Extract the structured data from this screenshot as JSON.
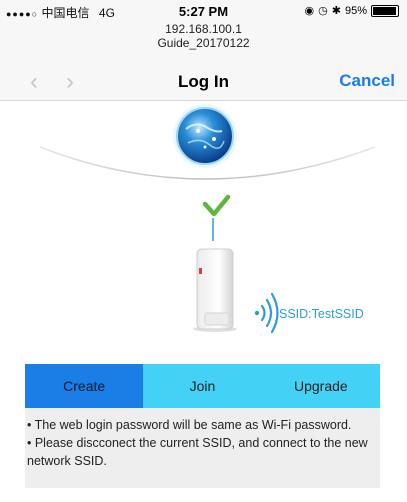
{
  "status": {
    "signal_dots": "●●●●○",
    "carrier": "中国电信",
    "network": "4G",
    "time": "5:27 PM",
    "icons": [
      "lock-rotation-icon",
      "alarm-icon",
      "bluetooth-icon"
    ],
    "battery": "95%",
    "battery_level": 0.95
  },
  "url": {
    "host": "192.168.100.1",
    "page": "Guide_20170122"
  },
  "nav": {
    "back_icon": "‹",
    "forward_icon": "›",
    "title": "Log In",
    "cancel_label": "Cancel"
  },
  "diagram": {
    "ssid_label": "SSID:TestSSID",
    "accent": "#2e9be0",
    "check_color": "#5db83a"
  },
  "tabs": {
    "items": [
      {
        "label": "Create",
        "active": true
      },
      {
        "label": "Join",
        "active": false
      },
      {
        "label": "Upgrade",
        "active": false
      }
    ]
  },
  "info": {
    "line1": "• The web login password will be same as Wi-Fi password.",
    "line2": "• Please discconect the current SSID, and connect to the new network SSID."
  }
}
